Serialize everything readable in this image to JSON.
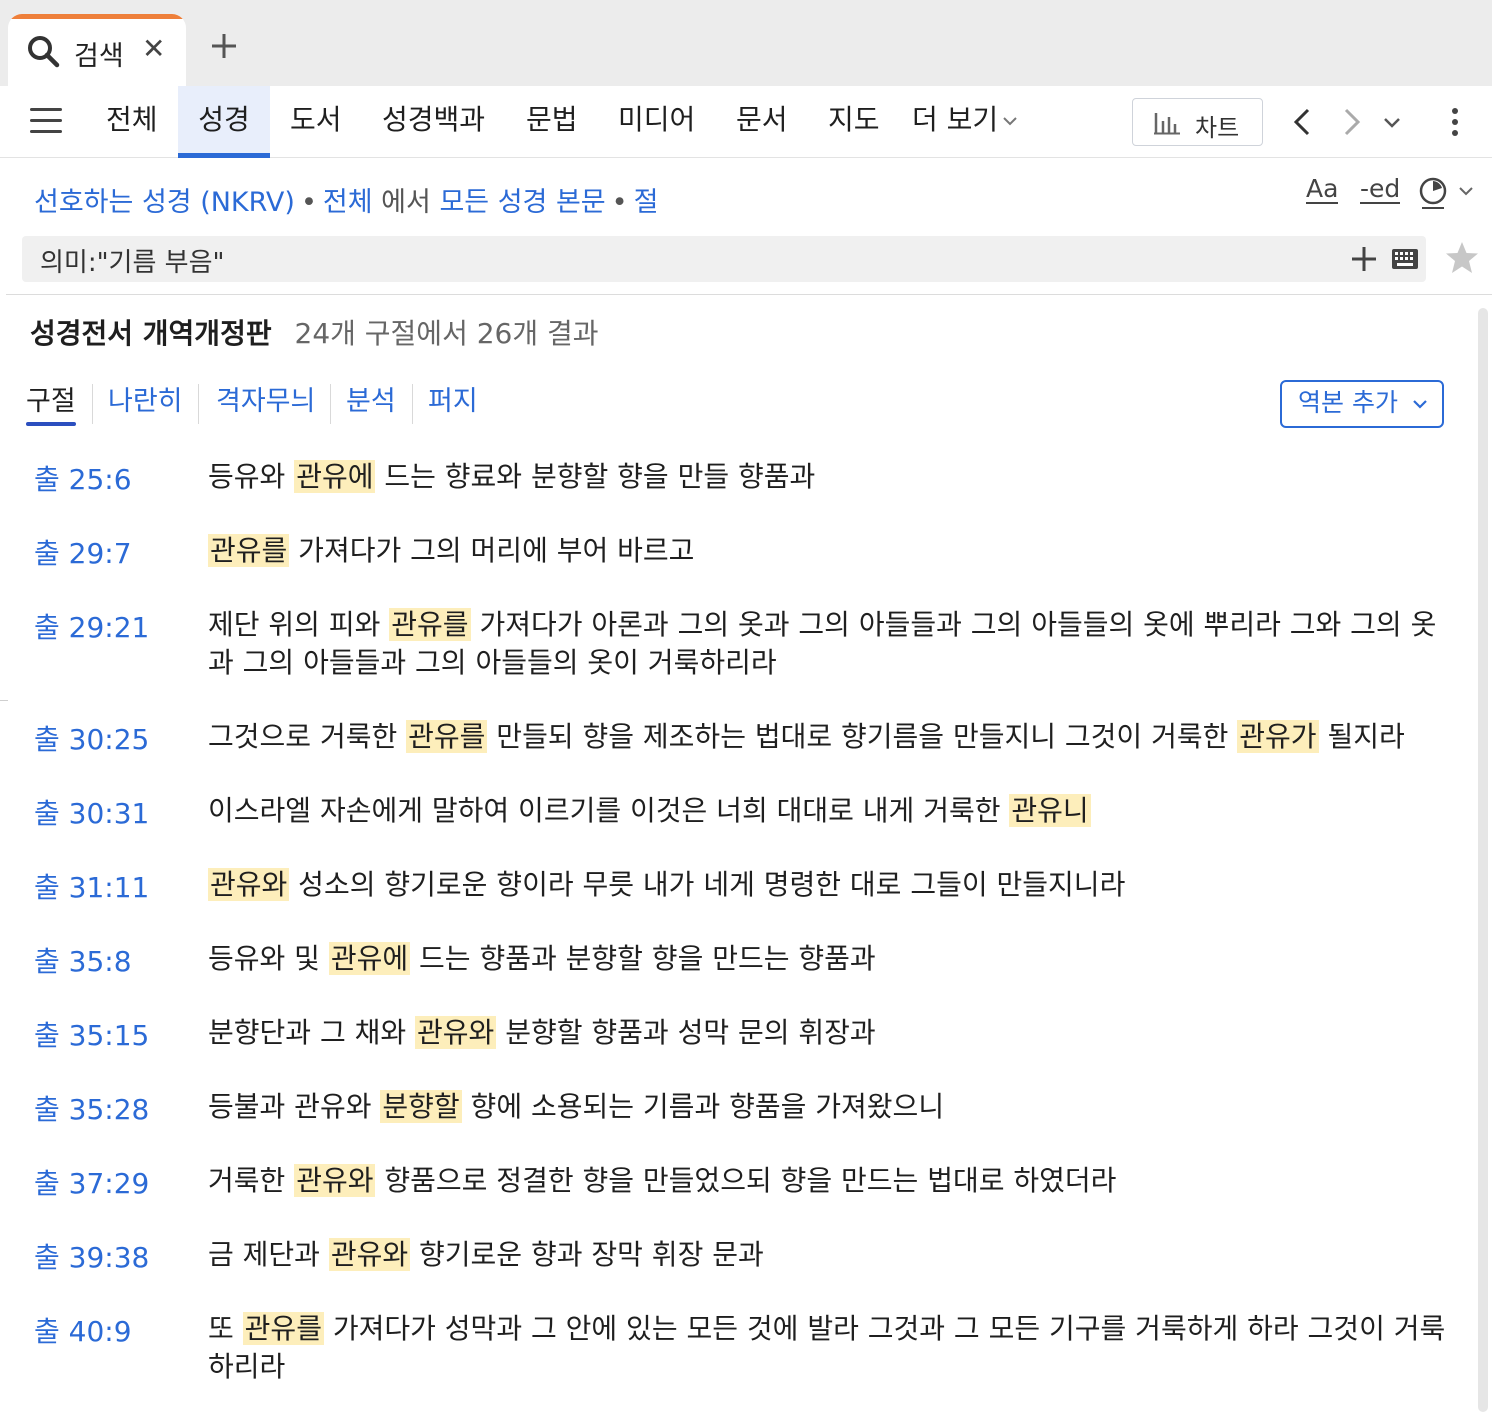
{
  "tab": {
    "label": "검색",
    "close": "✕"
  },
  "nav": {
    "items": [
      "전체",
      "성경",
      "도서",
      "성경백과",
      "문법",
      "미디어",
      "문서",
      "지도"
    ],
    "more": "더 보기",
    "chart": "차트"
  },
  "crumbs": {
    "preferred": "선호하는 성경 (NKRV)",
    "sep": "•",
    "scope": "전체",
    "in": "에서",
    "target": "모든 성경 본문",
    "unit": "절"
  },
  "tools": {
    "font": "Aa",
    "ed": "-ed"
  },
  "search": {
    "query": "의미:\"기름 부음\""
  },
  "results": {
    "title": "성경전서 개역개정판",
    "count": "24개 구절에서 26개 결과"
  },
  "subtabs": [
    "구절",
    "나란히",
    "격자무늬",
    "분석",
    "퍼지"
  ],
  "add_version": "역본 추가",
  "verses": [
    {
      "ref": "출 25:6",
      "parts": [
        "등유와 ",
        "관유에",
        " 드는 향료와 분향할 향을 만들 향품과"
      ]
    },
    {
      "ref": "출 29:7",
      "parts": [
        "",
        "관유를",
        " 가져다가 그의 머리에 부어 바르고"
      ]
    },
    {
      "ref": "출 29:21",
      "parts": [
        "제단 위의 피와 ",
        "관유를",
        " 가져다가 아론과 그의 옷과 그의 아들들과 그의 아들들의 옷에 뿌리라 그와 그의 옷과 그의 아들들과 그의 아들들의 옷이 거룩하리라"
      ]
    },
    {
      "ref": "출 30:25",
      "parts": [
        "그것으로 거룩한 ",
        "관유를",
        " 만들되 향을 제조하는 법대로 향기름을 만들지니 그것이 거룩한 ",
        "관유가",
        " 될지라"
      ]
    },
    {
      "ref": "출 30:31",
      "parts": [
        "이스라엘 자손에게 말하여 이르기를 이것은 너희 대대로 내게 거룩한 ",
        "관유니",
        ""
      ]
    },
    {
      "ref": "출 31:11",
      "parts": [
        "",
        "관유와",
        " 성소의 향기로운 향이라 무릇 내가 네게 명령한 대로 그들이 만들지니라"
      ]
    },
    {
      "ref": "출 35:8",
      "parts": [
        "등유와 및 ",
        "관유에",
        " 드는 향품과 분향할 향을 만드는 향품과"
      ]
    },
    {
      "ref": "출 35:15",
      "parts": [
        "분향단과 그 채와 ",
        "관유와",
        " 분향할 향품과 성막 문의 휘장과"
      ]
    },
    {
      "ref": "출 35:28",
      "parts": [
        "등불과 관유와 ",
        "분향할",
        " 향에 소용되는 기름과 향품을 가져왔으니"
      ]
    },
    {
      "ref": "출 37:29",
      "parts": [
        "거룩한 ",
        "관유와",
        " 향품으로 정결한 향을 만들었으되 향을 만드는 법대로 하였더라"
      ]
    },
    {
      "ref": "출 39:38",
      "parts": [
        "금 제단과 ",
        "관유와",
        " 향기로운 향과 장막 휘장 문과"
      ]
    },
    {
      "ref": "출 40:9",
      "parts": [
        "또 ",
        "관유를",
        " 가져다가 성막과 그 안에 있는 모든 것에 발라 그것과 그 모든 기구를 거룩하게 하라 그것이 거룩하리라"
      ]
    }
  ]
}
